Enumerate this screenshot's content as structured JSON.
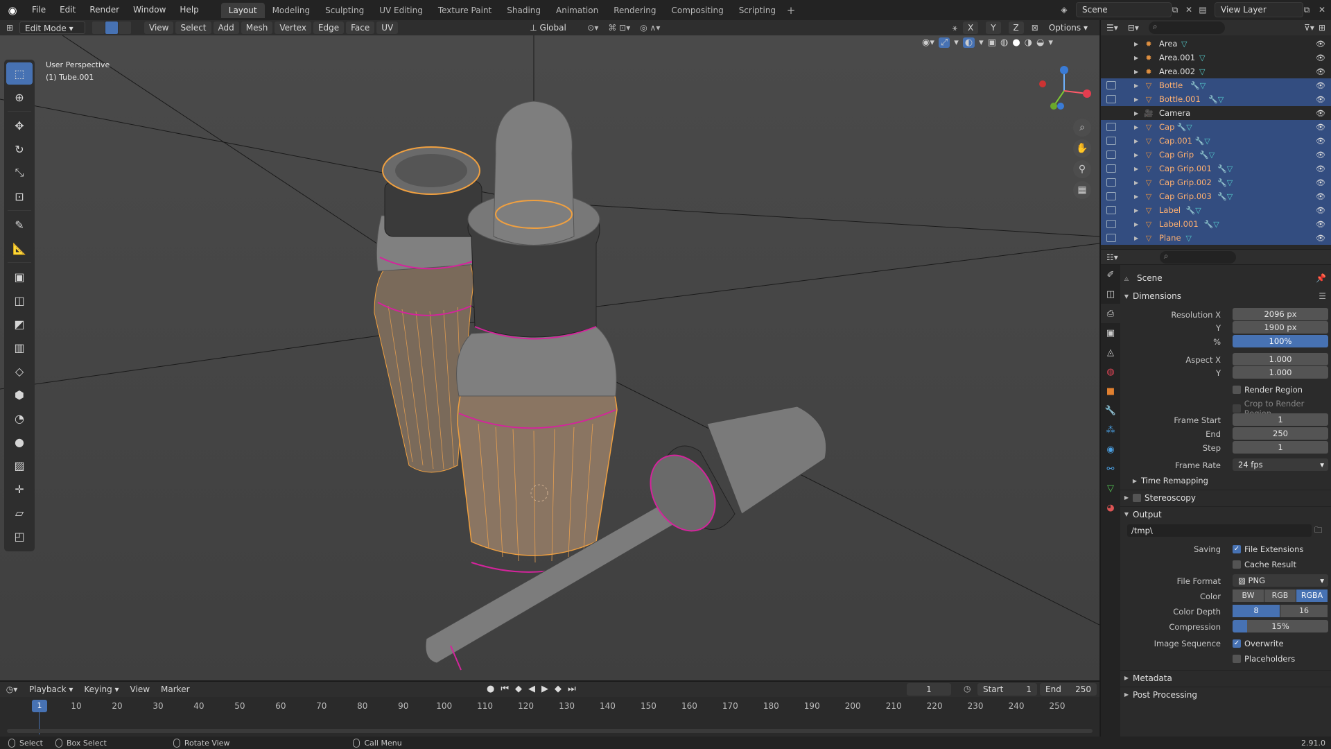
{
  "app": {
    "version": "2.91.0"
  },
  "menu": [
    "File",
    "Edit",
    "Render",
    "Window",
    "Help"
  ],
  "workspaces": [
    "Layout",
    "Modeling",
    "Sculpting",
    "UV Editing",
    "Texture Paint",
    "Shading",
    "Animation",
    "Rendering",
    "Compositing",
    "Scripting"
  ],
  "active_workspace": "Layout",
  "scene_name": "Scene",
  "view_layer_name": "View Layer",
  "viewport": {
    "mode": "Edit Mode",
    "menus": [
      "View",
      "Select",
      "Add",
      "Mesh",
      "Vertex",
      "Edge",
      "Face",
      "UV"
    ],
    "orientation": "Global",
    "options_label": "Options",
    "perspective_label": "User Perspective",
    "object_label": "(1) Tube.001",
    "axes": [
      "X",
      "Y",
      "Z"
    ]
  },
  "toolshelf": [
    "select-box",
    "cursor",
    "move",
    "rotate",
    "scale",
    "transform",
    "annotate",
    "measure",
    "extrude",
    "inset",
    "bevel",
    "loop-cut",
    "knife",
    "poly-build",
    "spin",
    "smooth",
    "edge-slide",
    "shrink-fatten",
    "shear",
    "rip"
  ],
  "timeline": {
    "menus": [
      "Playback",
      "Keying",
      "View",
      "Marker"
    ],
    "current_frame": "1",
    "start_label": "Start",
    "start": "1",
    "end_label": "End",
    "end": "250",
    "ticks": [
      "1",
      "10",
      "20",
      "30",
      "40",
      "50",
      "60",
      "70",
      "80",
      "90",
      "100",
      "110",
      "120",
      "130",
      "140",
      "150",
      "160",
      "170",
      "180",
      "190",
      "200",
      "210",
      "220",
      "230",
      "240",
      "250"
    ]
  },
  "statusbar": {
    "select": "Select",
    "box_select": "Box Select",
    "rotate": "Rotate View",
    "call_menu": "Call Menu"
  },
  "outliner": {
    "rows": [
      {
        "name": "Area",
        "type": "light",
        "selected": false,
        "mods": false
      },
      {
        "name": "Area.001",
        "type": "light",
        "selected": false,
        "mods": false
      },
      {
        "name": "Area.002",
        "type": "light",
        "selected": false,
        "mods": false
      },
      {
        "name": "Bottle",
        "type": "mesh",
        "selected": true,
        "mods": true
      },
      {
        "name": "Bottle.001",
        "type": "mesh",
        "selected": true,
        "mods": true
      },
      {
        "name": "Camera",
        "type": "camera",
        "selected": false,
        "mods": false
      },
      {
        "name": "Cap",
        "type": "mesh",
        "selected": true,
        "mods": true
      },
      {
        "name": "Cap.001",
        "type": "mesh",
        "selected": true,
        "mods": true
      },
      {
        "name": "Cap Grip",
        "type": "mesh",
        "selected": true,
        "mods": true
      },
      {
        "name": "Cap Grip.001",
        "type": "mesh",
        "selected": true,
        "mods": true
      },
      {
        "name": "Cap Grip.002",
        "type": "mesh",
        "selected": true,
        "mods": true
      },
      {
        "name": "Cap Grip.003",
        "type": "mesh",
        "selected": true,
        "mods": true
      },
      {
        "name": "Label",
        "type": "mesh",
        "selected": true,
        "mods": true
      },
      {
        "name": "Label.001",
        "type": "mesh",
        "selected": true,
        "mods": true
      },
      {
        "name": "Plane",
        "type": "mesh",
        "selected": true,
        "mods": false
      }
    ]
  },
  "properties": {
    "context": "Scene",
    "dimensions": {
      "title": "Dimensions",
      "res_x_label": "Resolution X",
      "res_x": "2096 px",
      "res_y_label": "Y",
      "res_y": "1900 px",
      "pct_label": "%",
      "pct": "100%",
      "aspect_x_label": "Aspect X",
      "aspect_x": "1.000",
      "aspect_y_label": "Y",
      "aspect_y": "1.000",
      "render_region": "Render Region",
      "crop_region": "Crop to Render Region",
      "frame_start_label": "Frame Start",
      "frame_start": "1",
      "end_label": "End",
      "end": "250",
      "step_label": "Step",
      "step": "1",
      "frame_rate_label": "Frame Rate",
      "frame_rate": "24 fps",
      "time_remapping": "Time Remapping"
    },
    "stereoscopy": "Stereoscopy",
    "output": {
      "title": "Output",
      "path": "/tmp\\",
      "saving_label": "Saving",
      "file_extensions": "File Extensions",
      "cache_result": "Cache Result",
      "file_format_label": "File Format",
      "file_format": "PNG",
      "color_label": "Color",
      "color_options": [
        "BW",
        "RGB",
        "RGBA"
      ],
      "color_selected": "RGBA",
      "depth_label": "Color Depth",
      "depth_options": [
        "8",
        "16"
      ],
      "depth_selected": "8",
      "compression_label": "Compression",
      "compression": "15%",
      "compression_value": 0.15,
      "image_sequence_label": "Image Sequence",
      "overwrite": "Overwrite",
      "placeholders": "Placeholders"
    },
    "metadata": "Metadata",
    "post_processing": "Post Processing"
  },
  "colors": {
    "accent": "#4772b3",
    "select_orange": "#f0a040",
    "seam_magenta": "#d4249c"
  }
}
